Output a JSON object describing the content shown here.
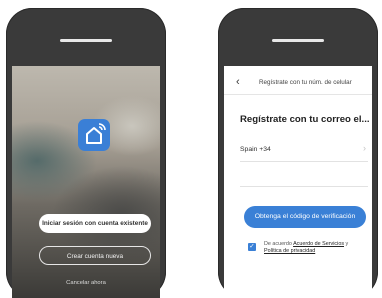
{
  "login_screen": {
    "login_button": "Iniciar sesión con cuenta existente",
    "create_account_button": "Crear cuenta nueva",
    "cancel_link": "Cancelar ahora",
    "logo_icon": "home-wifi-icon",
    "accent_color": "#3a7fd6"
  },
  "register_screen": {
    "back_icon": "chevron-left-icon",
    "nav_title": "Regístrate con tu núm. de celular",
    "heading": "Regístrate con tu correo el...",
    "country_value": "Spain +34",
    "verify_button": "Obtenga el código de verificación",
    "agree_prefix": "De acuerdo",
    "terms_link": "Acuerdo de Servicios",
    "agree_conjunction": "y",
    "privacy_link": "Política de privacidad",
    "checkbox_checked": true,
    "accent_color": "#3a80d6"
  }
}
